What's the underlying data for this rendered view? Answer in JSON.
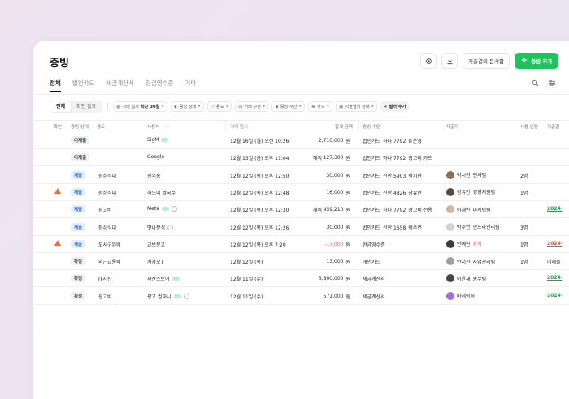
{
  "header": {
    "title": "증빙",
    "doc_request_label": "지출결의 문서함",
    "add_label": "증빙 추가"
  },
  "tabs": [
    {
      "label": "전체",
      "active": true
    },
    {
      "label": "법인카드",
      "active": false
    },
    {
      "label": "세금계산서",
      "active": false
    },
    {
      "label": "현금영수증",
      "active": false
    },
    {
      "label": "기타",
      "active": false
    }
  ],
  "filters": {
    "segment": [
      "전체",
      "확인 필요"
    ],
    "date_label": "거래 일자",
    "date_value": "최근 30일",
    "chips": [
      "증빙 상태",
      "용도",
      "거래 구분",
      "증빙 수단",
      "카드",
      "지출결의 상태"
    ],
    "add_filter": "필터 추가"
  },
  "columns": [
    "확인",
    "증빙 상태",
    "용도",
    "사용처",
    "거래 일시",
    "합계 금액",
    "증빙 수단",
    "제출자",
    "사용 인원",
    "지출결"
  ],
  "rows": [
    {
      "warn": false,
      "status": "미제출",
      "status_type": "gray",
      "purpose": "",
      "merchant": "SigM",
      "link": true,
      "doc": false,
      "date": "12월 16일 (월) 오전 10:26",
      "foreign": "",
      "amount": "2,710,000",
      "unit": "원",
      "method": "법인카드",
      "card": "하나 7792",
      "card_sub": "IT운영",
      "submitter": "",
      "submitter_sub": "",
      "avatar": "",
      "people": "",
      "due": "",
      "due_type": ""
    },
    {
      "warn": false,
      "status": "미제출",
      "status_type": "gray",
      "purpose": "",
      "merchant": "Google",
      "link": false,
      "doc": false,
      "date": "12월 13일 (금) 오후 11:04",
      "foreign": "해외",
      "amount": "127,300",
      "unit": "원",
      "method": "법인카드",
      "card": "하나 7792",
      "card_sub": "광고비 카드",
      "submitter": "",
      "submitter_sub": "",
      "avatar": "",
      "people": "",
      "due": "",
      "due_type": ""
    },
    {
      "warn": false,
      "status": "제출",
      "status_type": "blue",
      "purpose": "점심식대",
      "merchant": "진우동",
      "link": false,
      "doc": false,
      "date": "12월 12일 (목) 오후 12:50",
      "foreign": "",
      "amount": "30,000",
      "unit": "원",
      "method": "법인카드",
      "card": "신한 5903",
      "card_sub": "박시현",
      "submitter": "박시현",
      "submitter_sub": "인사팀",
      "avatar": "#8a6f5a",
      "people": "2명",
      "due": "",
      "due_type": ""
    },
    {
      "warn": true,
      "status": "제출",
      "status_type": "blue",
      "purpose": "점심식대",
      "merchant": "하노이 쌀국수",
      "link": false,
      "doc": false,
      "date": "12월 12일 (목) 오후 12:48",
      "foreign": "",
      "amount": "16,000",
      "unit": "원",
      "method": "법인카드",
      "card": "신한 4826",
      "card_sub": "장유안",
      "submitter": "장유안",
      "submitter_sub": "경영지원팀",
      "avatar": "#5a4a40",
      "people": "1명",
      "due": "",
      "due_type": ""
    },
    {
      "warn": false,
      "status": "제출",
      "status_type": "blue",
      "purpose": "광고비",
      "merchant": "Meta",
      "link": true,
      "doc": true,
      "date": "12월 12일 (목) 오후 12:30",
      "foreign": "해외",
      "amount": "459,210",
      "unit": "원",
      "method": "법인카드",
      "card": "하나 7792",
      "card_sub": "광고비 전용",
      "submitter": "이채린",
      "submitter_sub": "마케팅팀",
      "avatar": "#c9b7a8",
      "people": "",
      "due": "2024-",
      "due_type": "green"
    },
    {
      "warn": false,
      "status": "제출",
      "status_type": "blue",
      "purpose": "점심식대",
      "merchant": "맛나분식",
      "link": false,
      "doc": true,
      "date": "12월 12일 (목) 오후 12:26",
      "foreign": "",
      "amount": "30,000",
      "unit": "원",
      "method": "법인카드",
      "card": "신한 1658",
      "card_sub": "박주연",
      "submitter": "박주연",
      "submitter_sub": "인프라관리팀",
      "avatar": "#d8d0c6",
      "people": "3명",
      "due": "",
      "due_type": ""
    },
    {
      "warn": true,
      "status": "제출",
      "status_type": "blue",
      "purpose": "도서구입비",
      "merchant": "교보문고",
      "link": false,
      "doc": false,
      "date": "12월 12일 (목) 오후 7:20",
      "foreign": "",
      "amount": "-17,000",
      "unit": "원",
      "method": "현금영수증",
      "card": "",
      "card_sub": "",
      "submitter": "안예린",
      "submitter_sub": "휴직",
      "avatar": "#3e3a38",
      "people": "1명",
      "due": "2024-",
      "due_type": "red"
    },
    {
      "warn": false,
      "status": "확정",
      "status_type": "gray",
      "purpose": "외근교통비",
      "merchant": "카카오T",
      "link": false,
      "doc": false,
      "date": "12월 12일 (목)",
      "foreign": "",
      "amount": "13,000",
      "unit": "원",
      "method": "개인카드",
      "card": "",
      "card_sub": "",
      "submitter": "안서진",
      "submitter_sub": "사업관리팀",
      "avatar": "#9aa3a6",
      "people": "1명",
      "due": "미제출",
      "due_type": "gray"
    },
    {
      "warn": false,
      "status": "확정",
      "status_type": "gray",
      "purpose": "IT자산",
      "merchant": "자산스토어",
      "link": true,
      "doc": false,
      "date": "12월 11일 (수)",
      "foreign": "",
      "amount": "3,800,000",
      "unit": "원",
      "method": "세금계산서",
      "card": "",
      "card_sub": "",
      "submitter": "이윤재",
      "submitter_sub": "총무팀",
      "avatar": "#4a4340",
      "people": "",
      "due": "2024-",
      "due_type": "green"
    },
    {
      "warn": false,
      "status": "확정",
      "status_type": "gray",
      "purpose": "광고비",
      "merchant": "광고 컴퍼니",
      "link": true,
      "doc": true,
      "date": "12월 11일 (수)",
      "foreign": "",
      "amount": "571,000",
      "unit": "원",
      "method": "세금계산서",
      "card": "",
      "card_sub": "",
      "submitter": "마케팅팀",
      "submitter_sub": "",
      "avatar": "#a46be0",
      "people": "",
      "due": "2024-",
      "due_type": "green-plain"
    }
  ]
}
